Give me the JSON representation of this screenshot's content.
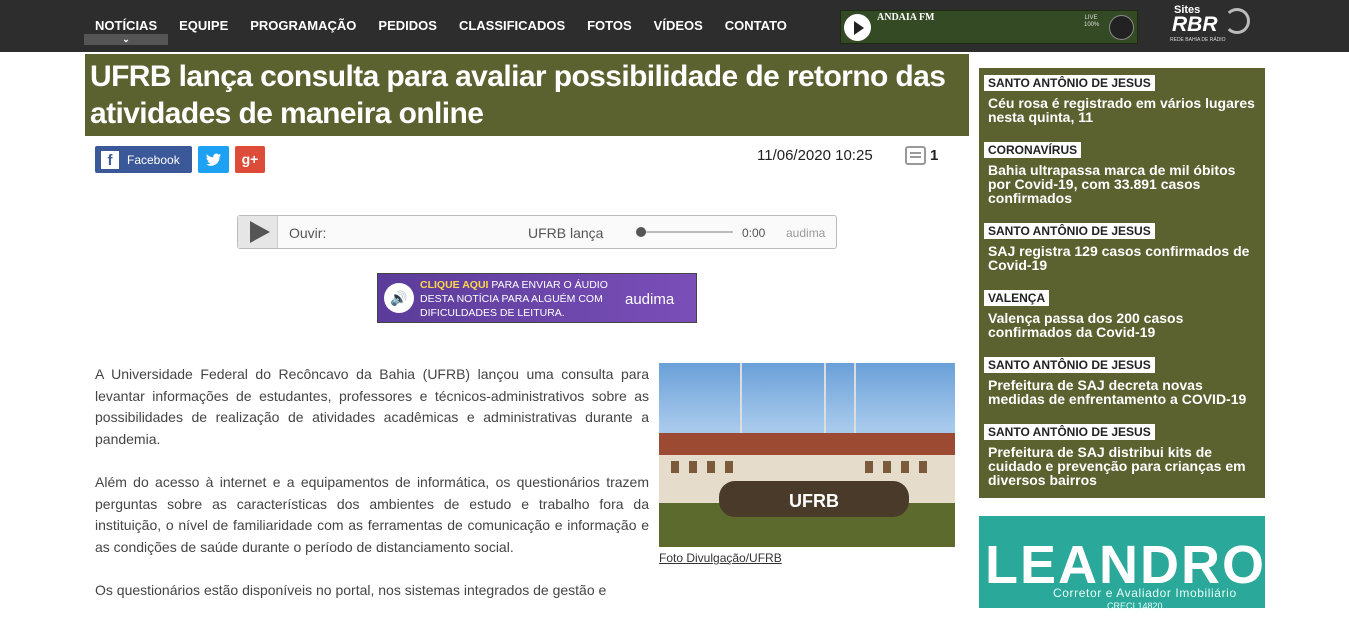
{
  "nav": {
    "items": [
      "NOTÍCIAS",
      "EQUIPE",
      "PROGRAMAÇÃO",
      "PEDIDOS",
      "CLASSIFICADOS",
      "FOTOS",
      "VÍDEOS",
      "CONTATO"
    ],
    "active_indicator": "chevron-down"
  },
  "radio": {
    "name": "ANDAIA FM",
    "live": "LIVE",
    "volume": "100%"
  },
  "brand": {
    "sites": "Sites",
    "logo": "RBR",
    "sub": "REDE BAHIA DE RÁDIO"
  },
  "article": {
    "title": "UFRB lança consulta para avaliar possibilidade de retorno das atividades de maneira online",
    "datetime": "11/06/2020 10:25",
    "comments": "1",
    "share": {
      "facebook": "Facebook",
      "gplus": "g+"
    },
    "player": {
      "label": "Ouvir:",
      "title": "UFRB lança",
      "time": "0:00",
      "brand": "audima",
      "progress": 0
    },
    "banner": {
      "highlight": "CLIQUE AQUI",
      "text": " PARA ENVIAR O ÁUDIO DESTA NOTÍCIA PARA ALGUÉM COM DIFICULDADES DE LEITURA.",
      "brand": "audima"
    },
    "paragraphs": [
      "A Universidade Federal do Recôncavo da Bahia (UFRB) lançou uma consulta para levantar informações de estudantes, professores e técnicos-administrativos sobre as possibilidades de realização de atividades acadêmicas e administrativas durante a pandemia.",
      "Além do acesso à internet e a equipamentos de informática, os questionários trazem perguntas sobre as características dos ambientes de estudo e trabalho fora da instituição, o nível de familiaridade com as ferramentas de comunicação e informação e as condições de saúde durante o período de distanciamento social.",
      "Os questionários estão disponíveis no portal, nos sistemas integrados de gestão e"
    ],
    "photo_sign": "UFRB",
    "photo_caption": "Foto Divulgação/UFRB"
  },
  "sidebar": {
    "items": [
      {
        "tag": "SANTO ANTÔNIO DE JESUS",
        "title": "Céu rosa é registrado em vários lugares nesta quinta, 11"
      },
      {
        "tag": "CORONAVÍRUS",
        "title": "Bahia ultrapassa marca de mil óbitos por Covid-19, com 33.891 casos confirmados"
      },
      {
        "tag": "SANTO ANTÔNIO DE JESUS",
        "title": "SAJ registra 129 casos confirmados de Covid-19"
      },
      {
        "tag": "VALENÇA",
        "title": "Valença passa dos 200 casos confirmados da Covid-19"
      },
      {
        "tag": "SANTO ANTÔNIO DE JESUS",
        "title": "Prefeitura de SAJ decreta novas medidas de enfrentamento a COVID-19"
      },
      {
        "tag": "SANTO ANTÔNIO DE JESUS",
        "title": "Prefeitura de SAJ distribui kits de cuidado e prevenção para crianças em diversos bairros"
      }
    ]
  },
  "ad": {
    "name": "LEANDRO",
    "sub": "Corretor e Avaliador Imobiliário",
    "creci": "CRECI 14820"
  }
}
